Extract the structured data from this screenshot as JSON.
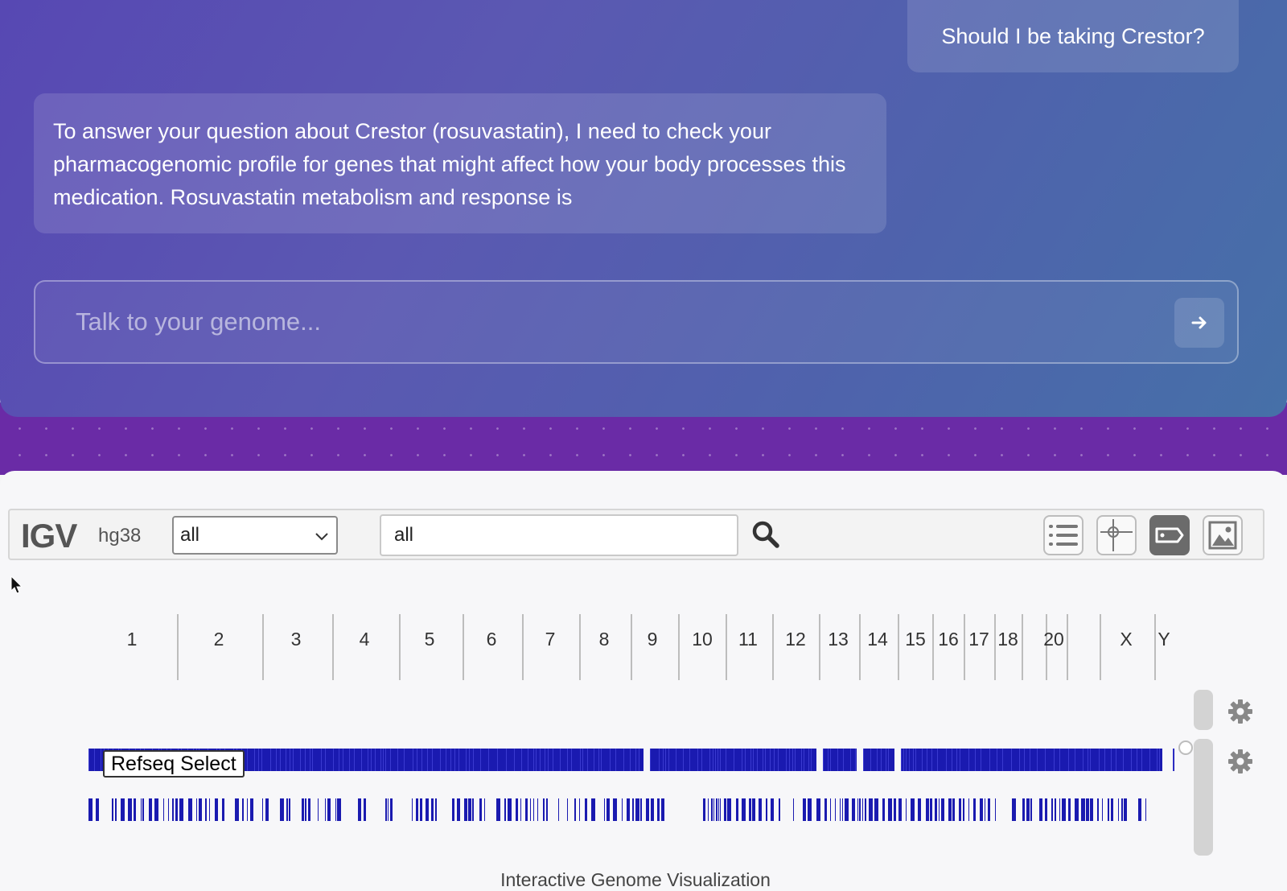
{
  "chat": {
    "user_message": "Should I be taking Crestor?",
    "assistant_message": "To answer your question about Crestor (rosuvastatin), I need to check your pharmacogenomic profile for genes that might affect how your body processes this medication. Rosuvastatin metabolism and response is",
    "input_placeholder": "Talk to your genome...",
    "send_icon": "arrow-right-icon"
  },
  "igv": {
    "logo": "IGV",
    "genome": "hg38",
    "chromosome_select": "all",
    "locus_value": "all",
    "icons": {
      "search": "search-icon",
      "track_list": "list-icon",
      "center_line": "crosshair-icon",
      "track_labels": "label-icon",
      "save_image": "image-icon",
      "settings": "gear-icon"
    },
    "chromosomes": [
      "1",
      "2",
      "3",
      "4",
      "5",
      "6",
      "7",
      "8",
      "9",
      "10",
      "11",
      "12",
      "13",
      "14",
      "15",
      "16",
      "17",
      "18",
      "20",
      "X",
      "Y"
    ],
    "track_name": "Refseq Select",
    "track_color": "#1a1ab0",
    "footer": "Interactive Genome Visualization"
  }
}
